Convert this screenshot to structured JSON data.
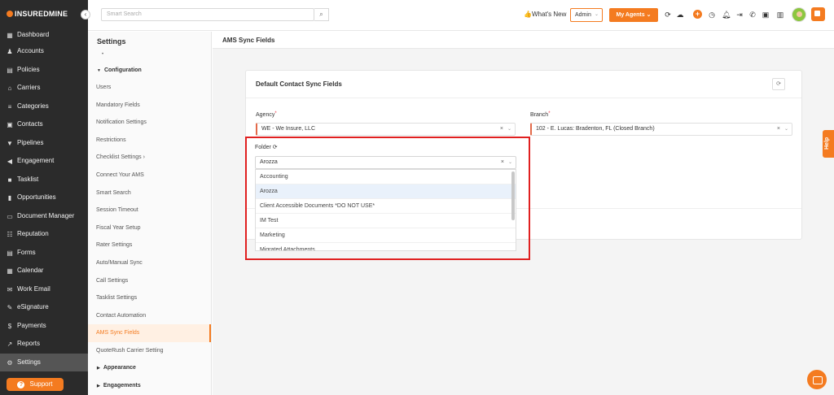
{
  "brand": {
    "logo": "INSUREDMINE",
    "accent": "#f47b20"
  },
  "sidebar": {
    "items": [
      {
        "label": "Dashboard",
        "icon": "grid-icon"
      },
      {
        "label": "Accounts",
        "icon": "people-icon"
      },
      {
        "label": "Policies",
        "icon": "policy-icon"
      },
      {
        "label": "Carriers",
        "icon": "bank-icon"
      },
      {
        "label": "Categories",
        "icon": "list-icon"
      },
      {
        "label": "Contacts",
        "icon": "contact-icon"
      },
      {
        "label": "Pipelines",
        "icon": "funnel-icon"
      },
      {
        "label": "Engagement",
        "icon": "megaphone-icon"
      },
      {
        "label": "Tasklist",
        "icon": "task-icon"
      },
      {
        "label": "Opportunities",
        "icon": "chart-icon"
      },
      {
        "label": "Document Manager",
        "icon": "folder-icon"
      },
      {
        "label": "Reputation",
        "icon": "reputation-icon"
      },
      {
        "label": "Forms",
        "icon": "form-icon"
      },
      {
        "label": "Calendar",
        "icon": "calendar-icon"
      },
      {
        "label": "Work Email",
        "icon": "mail-icon"
      },
      {
        "label": "eSignature",
        "icon": "signature-icon"
      },
      {
        "label": "Payments",
        "icon": "dollar-icon"
      },
      {
        "label": "Reports",
        "icon": "report-icon"
      },
      {
        "label": "Settings",
        "icon": "gear-icon"
      }
    ],
    "support_label": "Support"
  },
  "header": {
    "search_placeholder": "Smart Search",
    "whats_new": "What's New",
    "admin": "Admin",
    "my_agents": "My Agents"
  },
  "settings_nav": {
    "title": "Settings",
    "configuration": "Configuration",
    "items": [
      "Users",
      "Mandatory Fields",
      "Notification Settings",
      "Restrictions",
      "Checklist Settings",
      "Connect Your AMS",
      "Smart Search",
      "Session Timeout",
      "Fiscal Year Setup",
      "Rater Settings",
      "Auto/Manual Sync",
      "Call Settings",
      "Tasklist Settings",
      "Contact Automation",
      "AMS Sync Fields",
      "QuoteRush Carrier Setting"
    ],
    "appearance": "Appearance",
    "engagements": "Engagements"
  },
  "main": {
    "page_title": "AMS Sync Fields",
    "card_title": "Default Contact Sync Fields",
    "agency_label": "Agency",
    "agency_value": "WE - We Insure, LLC",
    "branch_label": "Branch",
    "branch_value": "102 - E. Lucas: Bradenton, FL (Closed Branch)",
    "folder_label": "Folder",
    "folder_value": "Arozza",
    "folder_options": [
      "Accounting",
      "Arozza",
      "Client Accessible Documents *DO NOT USE*",
      "IM Test",
      "Marketing",
      "Migrated Attachments"
    ],
    "help_label": "Help"
  }
}
